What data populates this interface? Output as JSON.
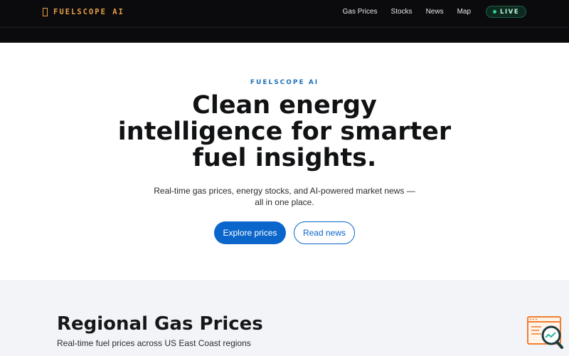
{
  "header": {
    "brand": "FUELSCOPE AI",
    "brand_icon": "flame-icon",
    "nav": [
      {
        "label": "Gas Prices"
      },
      {
        "label": "Stocks"
      },
      {
        "label": "News"
      },
      {
        "label": "Map"
      }
    ],
    "live_badge": "LIVE"
  },
  "hero": {
    "eyebrow": "FUELSCOPE AI",
    "headline": "Clean energy intelligence for smarter fuel insights.",
    "subtext": "Real-time gas prices, energy stocks, and AI-powered market news — all in one place.",
    "primary_cta": "Explore prices",
    "secondary_cta": "Read news"
  },
  "regional": {
    "title": "Regional Gas Prices",
    "subtitle": "Real-time fuel prices across US East Coast regions"
  },
  "widget": {
    "icon": "search-analytics-icon"
  },
  "colors": {
    "header_bg": "#0b0b0d",
    "brand": "#e6a048",
    "accent": "#0b66cc",
    "eyebrow": "#1f6fb7",
    "live": "#2fd28a",
    "section_bg": "#f3f4f7",
    "widget": "#f07f2e"
  }
}
